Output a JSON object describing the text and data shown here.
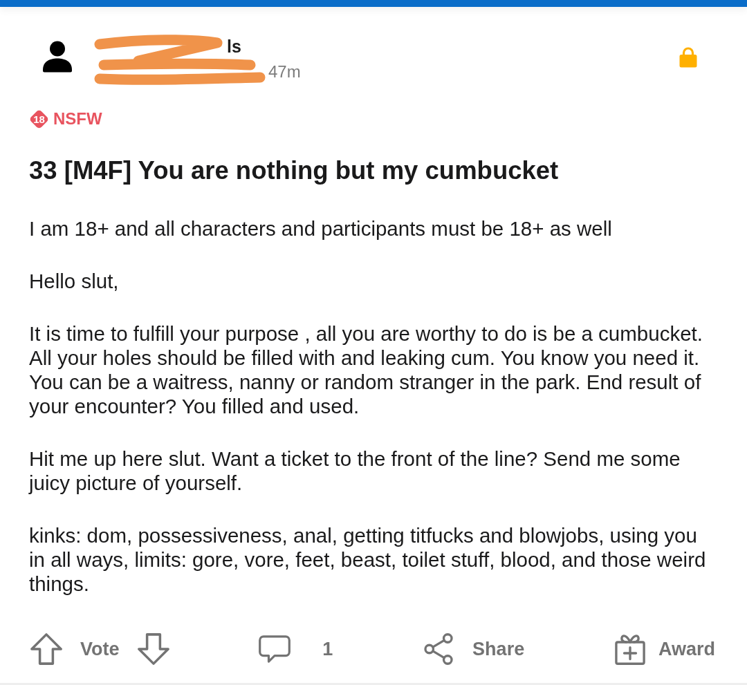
{
  "post": {
    "header": {
      "redacted": true,
      "name_line": "ls",
      "meta_line": "47m",
      "locked": true
    },
    "nsfw": {
      "badge": "18",
      "label": "NSFW"
    },
    "title": "33 [M4F] You are nothing but my cumbucket",
    "body": [
      "I am 18+ and all characters and participants must be 18+ as well",
      "Hello slut,",
      "It is time to fulfill your purpose , all you are worthy to do is be a cumbucket. All your holes should be filled with and leaking cum. You know you need it. You can be a waitress, nanny or random stranger in the park. End result of your encounter? You filled and used.",
      "Hit me up here slut. Want a ticket to the front of the line? Send me some juicy picture of yourself.",
      "kinks: dom, possessiveness, anal, getting titfucks and blowjobs, using you in all ways, limits: gore, vore, feet, beast, toilet stuff, blood, and those weird things."
    ],
    "actions": [
      {
        "kind": "vote",
        "label": "Vote"
      },
      {
        "kind": "comments",
        "label": "1"
      },
      {
        "kind": "share",
        "label": "Share"
      },
      {
        "kind": "award",
        "label": "Award"
      }
    ]
  }
}
